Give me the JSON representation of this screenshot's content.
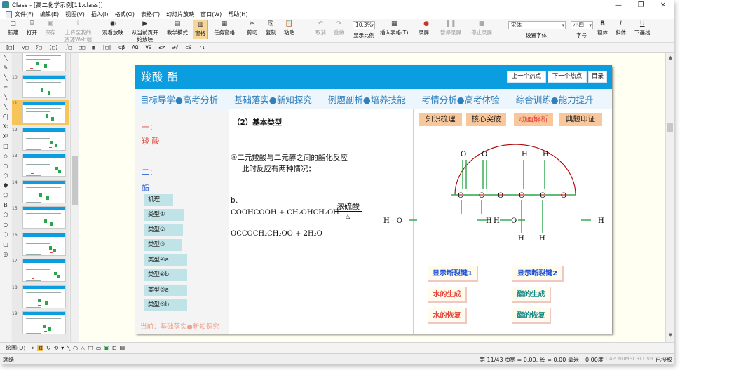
{
  "window": {
    "title": "Class - [高二化学示例[11.class]]"
  },
  "menu": [
    "文件(F)",
    "编辑(E)",
    "视图(V)",
    "插入(I)",
    "格式(O)",
    "表格(T)",
    "幻灯片放映",
    "窗口(W)",
    "帮助(H)"
  ],
  "toolbar": {
    "new": "新建",
    "open": "打开",
    "save": "保存",
    "upload": "上传至我的",
    "upload2": "资源Web端",
    "watch": "观看放映",
    "from_current": "从当前页开",
    "from_current2": "始放映",
    "teach_mode": "教学模式",
    "pane": "窗格",
    "task_pane": "任务窗格",
    "cut": "剪切",
    "copy": "复制",
    "paste": "粘贴",
    "undo": "取消",
    "redo": "重做",
    "zoom_value": "10.3%",
    "zoom_label": "显示比例",
    "insert_table": "插入表格(T)",
    "record": "录屏...",
    "pause_record": "暂停录屏",
    "stop_record": "停止录屏",
    "font_value": "宋体",
    "font_label": "设置字体",
    "size_value": "小四",
    "size_label": "字号",
    "bold": "粗体",
    "italic": "斜体",
    "underline": "下画线"
  },
  "formula_bar": [
    "[□]",
    "√□",
    "∑□",
    "(□)",
    "∫□",
    "□□",
    "▦",
    "|□|",
    "αβ",
    "ΛΩ",
    "∀∃",
    "≤≠",
    "∂√",
    "⊂∈",
    "∠↓"
  ],
  "left_tools": [
    "╲",
    "✎",
    "╲",
    "⌐",
    "╲",
    "╲",
    "C|",
    "X₂",
    "X²",
    "□",
    "◇",
    "○",
    "⬡",
    "⬢",
    "⬠",
    "B",
    "⬡",
    "○",
    "⬡",
    "▢",
    "◎"
  ],
  "thumbnails": [
    {
      "num": "",
      "selected": false
    },
    {
      "num": "10",
      "selected": false
    },
    {
      "num": "11",
      "selected": true
    },
    {
      "num": "12",
      "selected": false
    },
    {
      "num": "13",
      "selected": false
    },
    {
      "num": "14",
      "selected": false
    },
    {
      "num": "15",
      "selected": false
    },
    {
      "num": "16",
      "selected": false
    },
    {
      "num": "17",
      "selected": false
    },
    {
      "num": "18",
      "selected": false
    },
    {
      "num": "19",
      "selected": false
    }
  ],
  "slide": {
    "title": "羧酸    酯",
    "hotspot_prev": "上一个热点",
    "hotspot_next": "下一个热点",
    "toc": "目录",
    "nav": [
      "目标导学●高考分析",
      "基础落实●新知探究",
      "例题剖析●培养技能",
      "考情分析●高考体验",
      "综合训练●能力提升"
    ],
    "side": {
      "one": "一：",
      "one_item": "羧  酸",
      "two": "二：",
      "two_item": "酯",
      "items": [
        "机理",
        "类型①",
        "类型②",
        "类型③",
        "类型④a",
        "类型④b",
        "类型⑤a",
        "类型⑤b"
      ],
      "current": "当前：基础落实●新知探究"
    },
    "mid": {
      "heading": "（2）基本类型",
      "line1": "④二元羧酸与二元醇之间的酯化反应",
      "line2": "此时反应有两种情况：",
      "b": "b、",
      "eq1_left": "COOHCOOH + CH₂OHCH₂OH",
      "eq1_cond_top": "浓硫酸",
      "eq1_cond_bottom": "△",
      "eq2": "OCCOCH₂CH₂OO + 2H₂O"
    },
    "tags": [
      "知识梳理",
      "核心突破",
      "动画解析",
      "典题印证"
    ],
    "diagram": {
      "left_group": "H—O",
      "right_group": "—H",
      "c": "C",
      "o": "O",
      "h": "H"
    },
    "buttons": {
      "show1": "显示断裂键1",
      "show2": "显示断裂键2",
      "water": "水的生成",
      "ester": "酯的生成",
      "water_recover": "水的恢复",
      "ester_recover": "酯的恢复"
    }
  },
  "drawbar": {
    "label": "绘图(D)"
  },
  "status": {
    "ready": "就绪",
    "page": "第 11/43 页",
    "size": "宽 = 0.00, 长 = 0.00 毫米",
    "angle": "0.00度",
    "caps": "CAP",
    "num": "NUM",
    "scrl": "SCRL",
    "ovr": "OVR",
    "auth": "已授权"
  },
  "colors": {
    "accent": "#0a9ee0",
    "nav_text": "#2d7fbd",
    "green": "#2aa64a",
    "red": "#e04a3b",
    "tag": "#f8c79c"
  }
}
